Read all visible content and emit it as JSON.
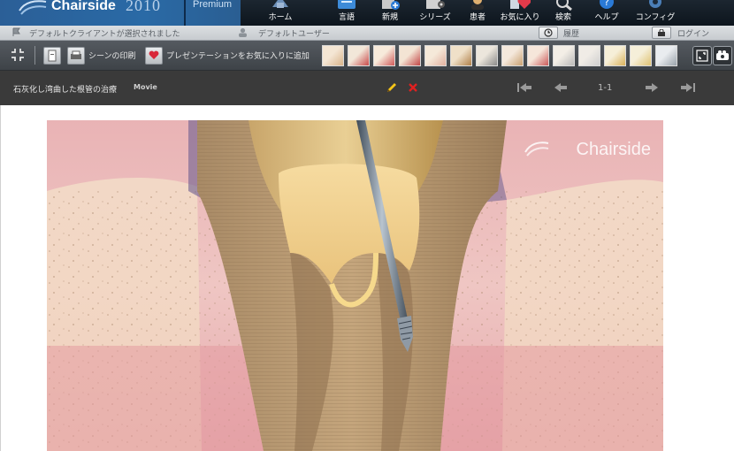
{
  "app": {
    "name": "Chairside",
    "year": "2010",
    "edition": "Premium"
  },
  "nav": [
    {
      "id": "home",
      "label": "ホーム",
      "icon": "home-icon"
    },
    {
      "id": "language",
      "label": "言語",
      "icon": "language-icon"
    },
    {
      "id": "new",
      "label": "新規",
      "icon": "new-icon"
    },
    {
      "id": "series",
      "label": "シリーズ",
      "icon": "series-icon"
    },
    {
      "id": "patient",
      "label": "患者",
      "icon": "patient-icon"
    },
    {
      "id": "favorites",
      "label": "お気に入り",
      "icon": "favorites-icon"
    },
    {
      "id": "search",
      "label": "検索",
      "icon": "search-icon"
    },
    {
      "id": "help",
      "label": "ヘルプ",
      "icon": "help-icon"
    },
    {
      "id": "config",
      "label": "コンフィグ",
      "icon": "config-icon"
    }
  ],
  "status": {
    "client": "デフォルトクライアントが選択されました",
    "user": "デフォルトユーザー",
    "history": "履歴",
    "login": "ログイン"
  },
  "toolbar": {
    "print_label": "シーンの印刷",
    "add_fav_label": "プレゼンテーションをお気に入りに追加",
    "thumbnail_count": 14
  },
  "scene": {
    "title": "石灰化し湾曲した根管の治療",
    "type": "Movie",
    "pager": "1-1",
    "watermark": "Chairside"
  },
  "colors": {
    "brand": "#2a6aa6",
    "toolbar": "#4a4f54",
    "titlebar": "#3a3a3a",
    "edit": "#f5c518",
    "delete": "#e02020"
  }
}
